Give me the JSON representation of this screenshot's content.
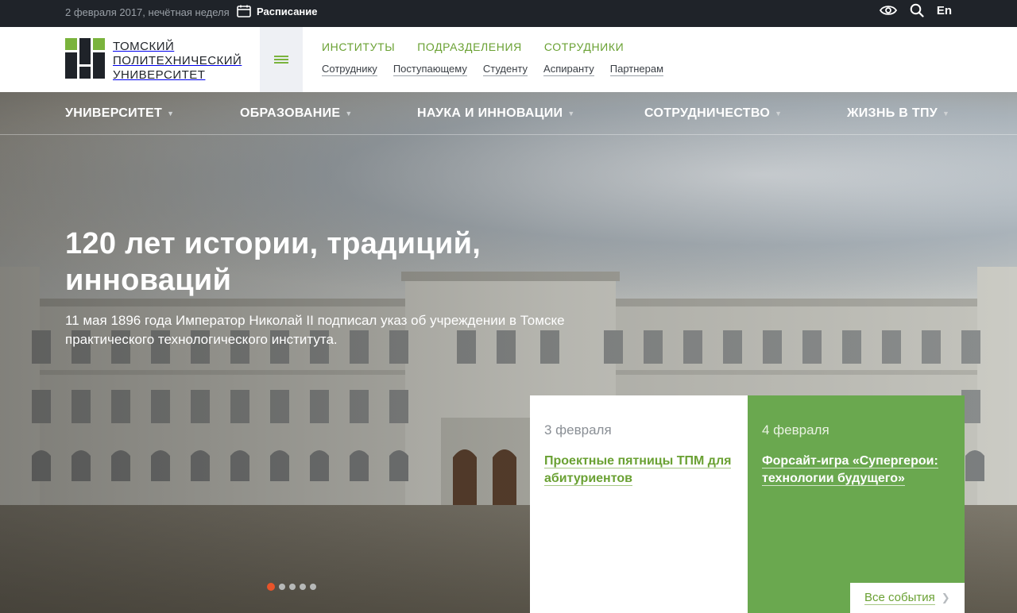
{
  "topbar": {
    "date": "2 февраля 2017, нечётная неделя",
    "schedule_label": "Расписание",
    "lang": "En"
  },
  "logo": {
    "line1": "ТОМСКИЙ",
    "line2": "ПОЛИТЕХНИЧЕСКИЙ",
    "line3": "УНИВЕРСИТЕТ"
  },
  "primary_links": [
    "ИНСТИТУТЫ",
    "ПОДРАЗДЕЛЕНИЯ",
    "СОТРУДНИКИ"
  ],
  "secondary_links": [
    "Сотруднику",
    "Поступающему",
    "Студенту",
    "Аспиранту",
    "Партнерам"
  ],
  "main_nav": [
    "УНИВЕРСИТЕТ",
    "ОБРАЗОВАНИЕ",
    "НАУКА И ИННОВАЦИИ",
    "СОТРУДНИЧЕСТВО",
    "ЖИЗНЬ В ТПУ"
  ],
  "hero": {
    "title": "120 лет истории, традиций, инноваций",
    "subtitle": "11 мая 1896 года Император Николай II подписал указ об учреждении в Томске практического технологического института.",
    "slide_count": 5,
    "active_slide": 1
  },
  "events": [
    {
      "date": "3 февраля",
      "title": "Проектные пятницы ТПМ для абитуриентов"
    },
    {
      "date": "4 февраля",
      "title": "Форсайт-игра «Супергерои: технологии будущего»"
    }
  ],
  "all_events_label": "Все события",
  "colors": {
    "brand_green": "#6aa84f",
    "topbar": "#1f2329",
    "active_dot": "#e8542a"
  }
}
